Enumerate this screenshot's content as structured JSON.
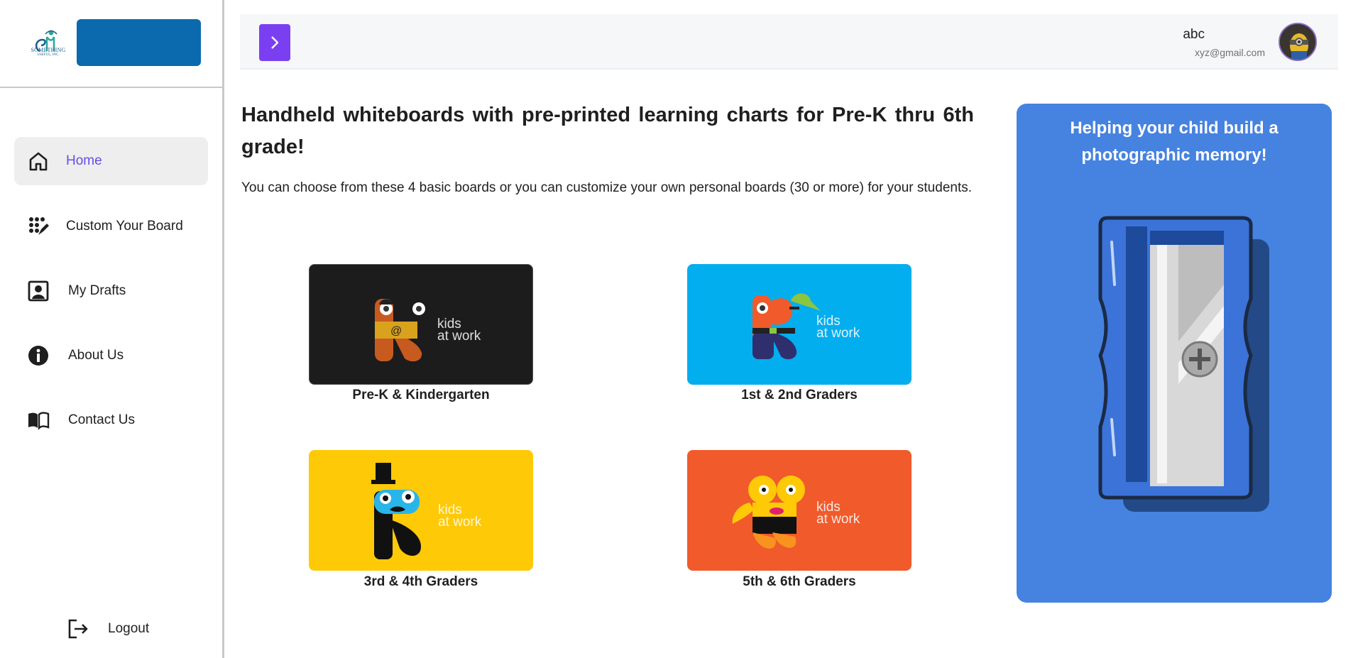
{
  "sidebar": {
    "logo_text": "SOMETHING",
    "logo_subtext": "USEFUL, INC.",
    "items": [
      {
        "label": "Home",
        "icon": "home-icon",
        "active": true
      },
      {
        "label": "Custom Your Board",
        "icon": "palette-icon",
        "active": false
      },
      {
        "label": "My Drafts",
        "icon": "drafts-icon",
        "active": false
      },
      {
        "label": "About Us",
        "icon": "info-icon",
        "active": false
      },
      {
        "label": "Contact Us",
        "icon": "book-icon",
        "active": false
      }
    ],
    "logout_label": "Logout"
  },
  "header": {
    "toggle_icon": "chevron-right-icon",
    "user_name": "abc",
    "user_email": "xyz@gmail.com"
  },
  "main": {
    "headline": "Handheld whiteboards with pre-printed learning charts for Pre-K thru 6th grade!",
    "description": "You can choose from these 4 basic boards or you can customize your own personal boards (30 or more) for your students.",
    "boards": [
      {
        "caption": "Pre-K & Kindergarten",
        "brand": "kids at work",
        "color": "#1c1c1c"
      },
      {
        "caption": "1st & 2nd Graders",
        "brand": "kids at work",
        "color": "#03aeef"
      },
      {
        "caption": "3rd & 4th Graders",
        "brand": "kids at work",
        "color": "#fec907"
      },
      {
        "caption": "5th & 6th Graders",
        "brand": "kids at work",
        "color": "#f15a2b"
      }
    ]
  },
  "promo": {
    "title": "Helping your child build a photographic memory!",
    "color": "#4682e0"
  },
  "colors": {
    "accent": "#7b3ff2",
    "active_nav_text": "#6a4ce6",
    "logo_banner": "#0b6aad"
  }
}
